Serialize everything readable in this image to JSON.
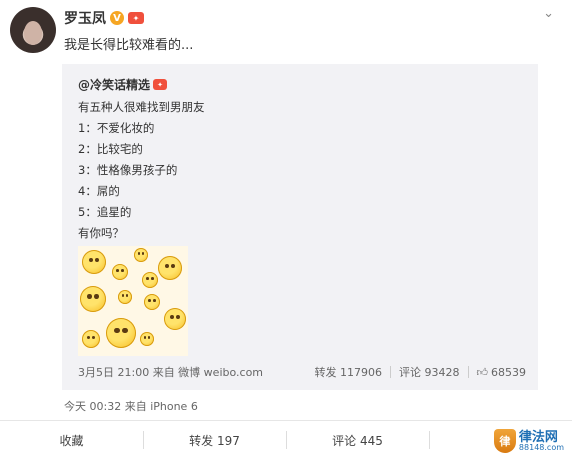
{
  "post": {
    "author": "罗玉凤",
    "verified_badge": "V",
    "text": "我是长得比较难看的..."
  },
  "repost": {
    "author": "@冷笑话精选",
    "lines": [
      "有五种人很难找到男朋友",
      "1：不爱化妆的",
      "2：比较宅的",
      "3：性格像男孩子的",
      "4：屌的",
      "5：追星的",
      "有你吗？"
    ],
    "meta": "3月5日 21:00 来自 微博 weibo.com",
    "reposts": "转发 117906",
    "comments": "评论 93428",
    "likes": "68539"
  },
  "post_meta": "今天 00:32 来自 iPhone 6",
  "actions": {
    "favorite": "收藏",
    "repost": "转发 197",
    "comment": "评论 445"
  },
  "icons": {
    "more": "chevron-down-icon",
    "like": "thumbs-up-icon"
  },
  "colors": {
    "repost_bg": "#f2f2f5",
    "vip_badge": "#f0503c",
    "verified": "#f6a623"
  }
}
